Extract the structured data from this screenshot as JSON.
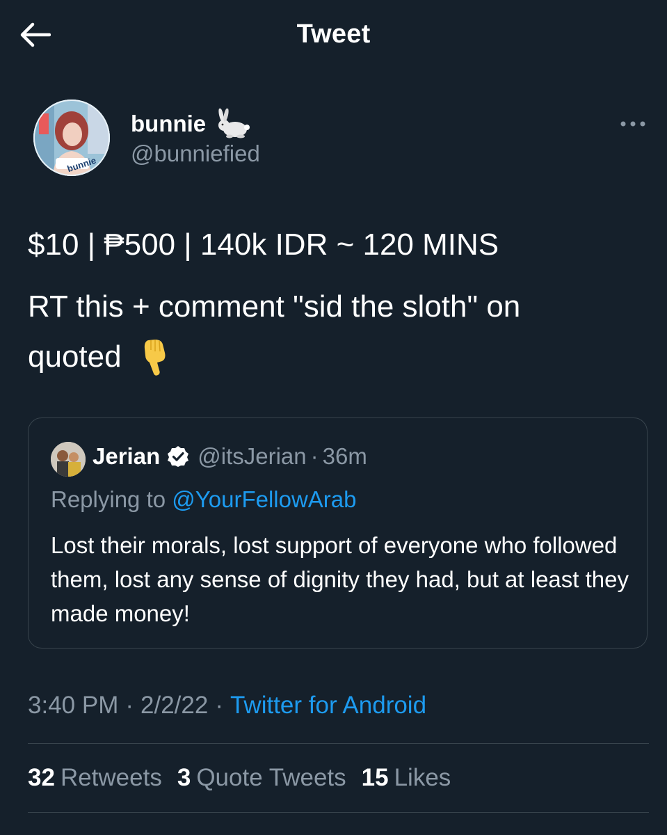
{
  "header": {
    "title": "Tweet",
    "back_icon": "arrow-left-icon"
  },
  "author": {
    "name": "bunnie",
    "handle": "@bunniefied",
    "avatar_badge_text": "bunnie",
    "name_emoji": "rabbit-icon"
  },
  "tweet": {
    "line1": "$10 | ₱500 | 140k IDR ~ 120 MINS",
    "line2": "RT this + comment \"sid the sloth\" on",
    "line3": "quoted",
    "emoji": "backhand-index-pointing-down-icon"
  },
  "quoted_tweet": {
    "name": "Jerian",
    "handle": "@itsJerian",
    "dot": "·",
    "time": "36m",
    "replying_prefix": "Replying to ",
    "replying_to": "@YourFellowArab",
    "text": "Lost their morals, lost support of everyone who followed them, lost any sense of dignity they had, but at least they made money!"
  },
  "meta": {
    "time": "3:40 PM",
    "sep1": "·",
    "date": "2/2/22",
    "sep2": "·",
    "source": "Twitter for Android"
  },
  "stats": {
    "retweets_count": "32",
    "retweets_label": "Retweets",
    "quotes_count": "3",
    "quotes_label": "Quote Tweets",
    "likes_count": "15",
    "likes_label": "Likes"
  },
  "colors": {
    "background": "#15202b",
    "secondary_text": "#8b98a5",
    "link": "#1d9bf0",
    "border": "#38444d"
  }
}
